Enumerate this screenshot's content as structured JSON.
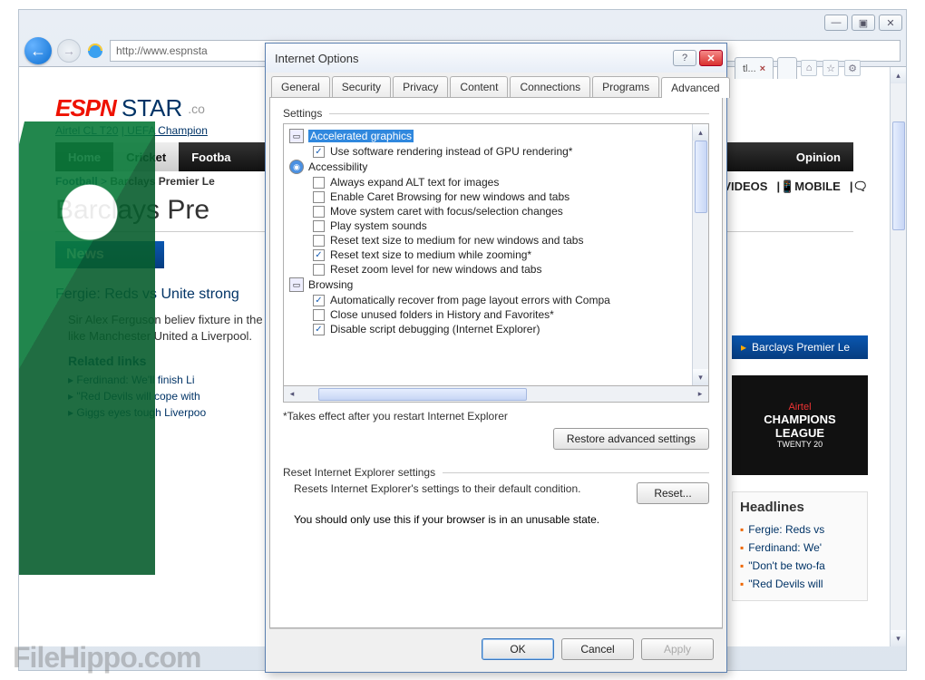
{
  "browser": {
    "address": "http://www.espnsta",
    "tab_label_suffix": "tl...",
    "titlebar": {
      "min": "—",
      "max": "▣",
      "close": "✕"
    },
    "tools": {
      "home": "⌂",
      "star": "☆",
      "gear": "⚙"
    }
  },
  "page": {
    "logo": {
      "espn": "ESPN",
      "star": "STAR",
      "dotcom": ".co"
    },
    "sublinks": {
      "a": "Airtel CL T20",
      "sep": " | ",
      "b": "UEFA Champion"
    },
    "extlinks": {
      "videos": "VIDEOS",
      "mobile": "|📱MOBILE",
      "chat": "|🗨"
    },
    "nav": {
      "home": "Home",
      "cricket": "Cricket",
      "football": "Footba",
      "opinion": "Opinion"
    },
    "crumb": {
      "a": "Football",
      "sep": " > ",
      "b": "Barclays Premier Le"
    },
    "h1": "Barclays Pre",
    "news_label": "News",
    "news_strip_right": "Barclays Premier Le",
    "article": {
      "title": "Fergie: Reds vs Unite                           strong",
      "body": "Sir Alex Ferguson believ                               fixture in the Premier Le                                like Manchester United a                              Liverpool.",
      "related_label": "Related links",
      "links": [
        "Ferdinand: We'll finish Li",
        "\"Red Devils will cope with",
        "Giggs eyes tough Liverpoo"
      ]
    },
    "ad": {
      "top": "Airtel",
      "mid": "CHAMPIONS",
      "mid2": "LEAGUE",
      "bot": "TWENTY 20"
    },
    "headlines": {
      "title": "Headlines",
      "items": [
        "Fergie: Reds vs",
        "Ferdinand: We'",
        "\"Don't be two-fa",
        "\"Red Devils will"
      ]
    }
  },
  "dialog": {
    "title": "Internet Options",
    "tabs": [
      "General",
      "Security",
      "Privacy",
      "Content",
      "Connections",
      "Programs",
      "Advanced"
    ],
    "active_tab": 6,
    "settings_label": "Settings",
    "tree": {
      "sect1": "Accelerated graphics",
      "o1": {
        "c": true,
        "t": "Use software rendering instead of GPU rendering*"
      },
      "sect2": "Accessibility",
      "o2": {
        "c": false,
        "t": "Always expand ALT text for images"
      },
      "o3": {
        "c": false,
        "t": "Enable Caret Browsing for new windows and tabs"
      },
      "o4": {
        "c": false,
        "t": "Move system caret with focus/selection changes"
      },
      "o5": {
        "c": false,
        "t": "Play system sounds"
      },
      "o6": {
        "c": false,
        "t": "Reset text size to medium for new windows and tabs"
      },
      "o7": {
        "c": true,
        "t": "Reset text size to medium while zooming*"
      },
      "o8": {
        "c": false,
        "t": "Reset zoom level for new windows and tabs"
      },
      "sect3": "Browsing",
      "o9": {
        "c": true,
        "t": "Automatically recover from page layout errors with Compa"
      },
      "o10": {
        "c": false,
        "t": "Close unused folders in History and Favorites*"
      },
      "o11": {
        "c": true,
        "t": "Disable script debugging (Internet Explorer)"
      }
    },
    "restart_note": "*Takes effect after you restart Internet Explorer",
    "restore_btn": "Restore advanced settings",
    "reset_label": "Reset Internet Explorer settings",
    "reset_text": "Resets Internet Explorer's settings to their default condition.",
    "reset_btn": "Reset...",
    "reset_warn": "You should only use this if your browser is in an unusable state.",
    "ok": "OK",
    "cancel": "Cancel",
    "apply": "Apply"
  },
  "watermark": "FileHippo.com"
}
